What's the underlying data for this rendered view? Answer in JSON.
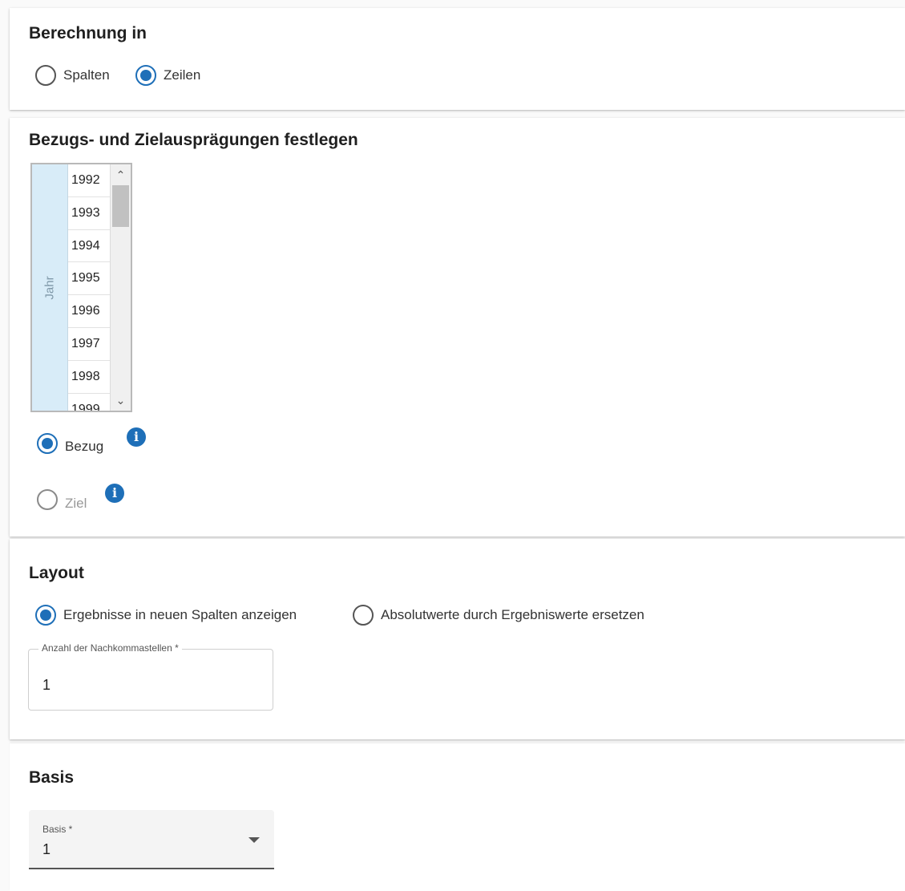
{
  "calculation": {
    "title": "Berechnung in",
    "options": [
      {
        "label": "Spalten",
        "checked": false
      },
      {
        "label": "Zeilen",
        "checked": true
      }
    ]
  },
  "reference": {
    "title": "Bezugs- und Zielausprägungen festlegen",
    "axis_label": "Jahr",
    "years": [
      "1992",
      "1993",
      "1994",
      "1995",
      "1996",
      "1997",
      "1998",
      "1999"
    ],
    "scroll_up_icon": "chevron-up-icon",
    "scroll_down_icon": "chevron-down-icon",
    "options": [
      {
        "label": "Bezug",
        "checked": true,
        "disabled": false,
        "info_icon": "info-icon"
      },
      {
        "label": "Ziel",
        "checked": false,
        "disabled": true,
        "info_icon": "info-icon"
      }
    ]
  },
  "layout": {
    "title": "Layout",
    "options": [
      {
        "label": "Ergebnisse in neuen Spalten anzeigen",
        "checked": true
      },
      {
        "label": "Absolutwerte durch Ergebniswerte ersetzen",
        "checked": false
      }
    ],
    "decimals_field": {
      "label": "Anzahl der Nachkommastellen *",
      "value": "1"
    }
  },
  "basis": {
    "title": "Basis",
    "select": {
      "label": "Basis *",
      "value": "1",
      "caret_icon": "caret-down-icon"
    }
  },
  "colors": {
    "accent": "#1e6fb8",
    "axis_background": "#d8ecf8"
  }
}
